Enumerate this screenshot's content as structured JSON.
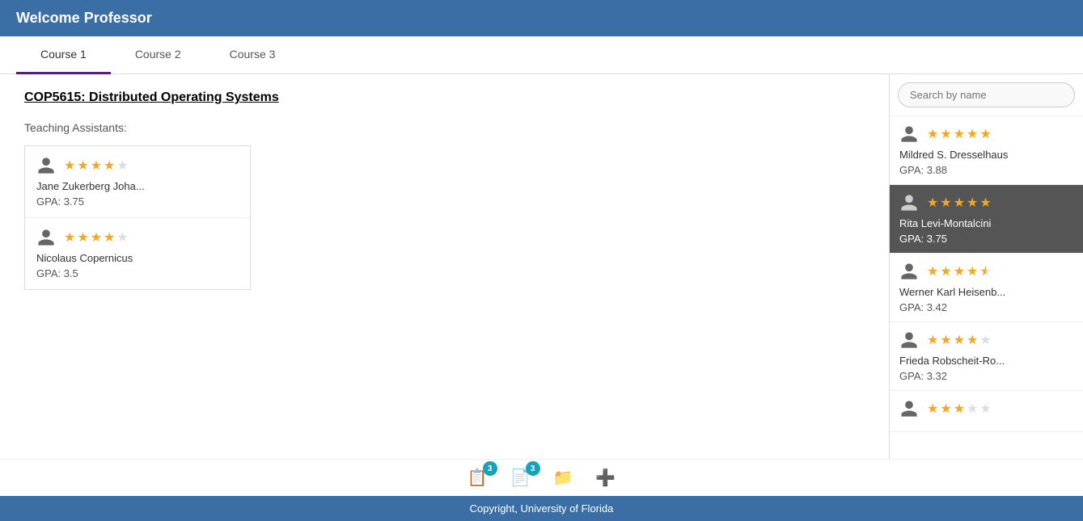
{
  "header": {
    "title": "Welcome Professor"
  },
  "tabs": [
    {
      "label": "Course 1",
      "active": true
    },
    {
      "label": "Course 2",
      "active": false
    },
    {
      "label": "Course 3",
      "active": false
    }
  ],
  "course": {
    "title": "COP5615: Distributed Operating Systems",
    "section_label": "Teaching Assistants:"
  },
  "teaching_assistants": [
    {
      "name": "Jane Zukerberg Joha...",
      "gpa": "GPA: 3.75",
      "stars": [
        1,
        1,
        1,
        1,
        0
      ]
    },
    {
      "name": "Nicolaus Copernicus",
      "gpa": "GPA: 3.5",
      "stars": [
        1,
        1,
        1,
        1,
        0
      ]
    }
  ],
  "search": {
    "placeholder": "Search by name"
  },
  "candidates": [
    {
      "name": "Mildred S. Dresselhaus",
      "gpa": "GPA: 3.88",
      "stars": [
        1,
        1,
        1,
        1,
        1
      ],
      "highlighted": false
    },
    {
      "name": "Rita Levi-Montalcini",
      "gpa": "GPA: 3.75",
      "stars": [
        1,
        1,
        1,
        1,
        1
      ],
      "highlighted": true
    },
    {
      "name": "Werner Karl Heisenb...",
      "gpa": "GPA: 3.42",
      "stars": [
        1,
        1,
        1,
        1,
        0.5
      ],
      "highlighted": false
    },
    {
      "name": "Frieda Robscheit-Ro...",
      "gpa": "GPA: 3.32",
      "stars": [
        1,
        1,
        1,
        1,
        0
      ],
      "highlighted": false
    },
    {
      "name": "...",
      "gpa": "",
      "stars": [
        1,
        1,
        1,
        0,
        0
      ],
      "highlighted": false
    }
  ],
  "toolbar": {
    "buttons": [
      {
        "icon": "📋",
        "badge": 3
      },
      {
        "icon": "📄",
        "badge": 3
      },
      {
        "icon": "📁",
        "badge": null
      },
      {
        "icon": "➕",
        "badge": null
      }
    ]
  },
  "footer": {
    "text": "Copyright, University of Florida"
  }
}
